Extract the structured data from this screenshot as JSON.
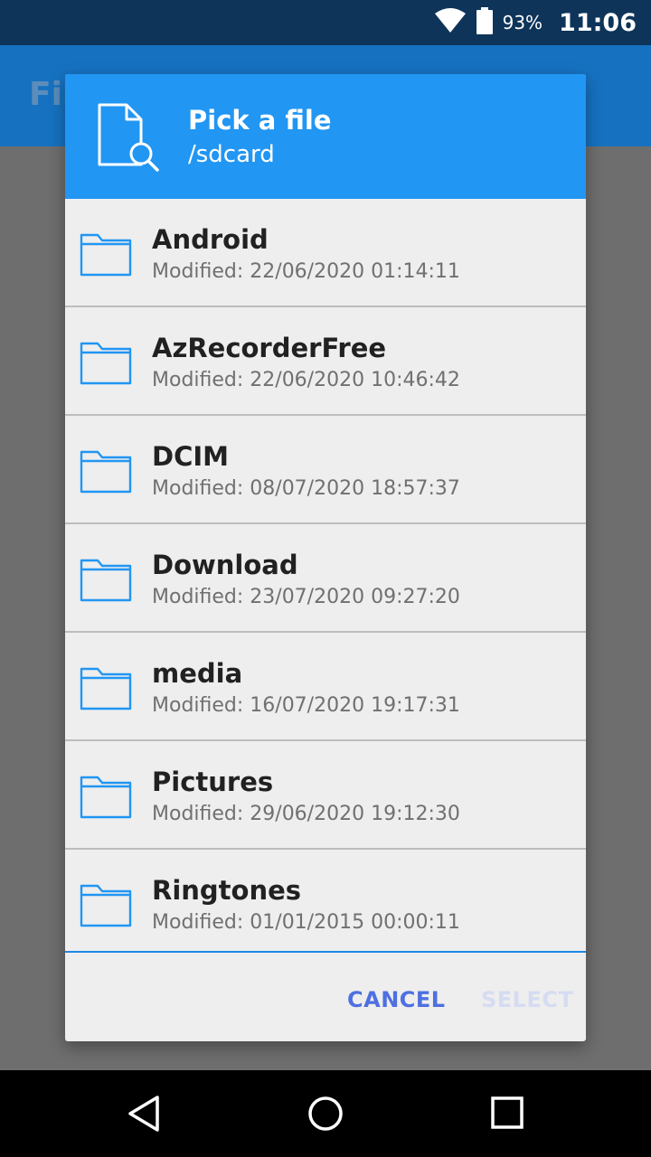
{
  "status_bar": {
    "battery_pct": "93%",
    "time": "11:06"
  },
  "app": {
    "title_partial": "Fil"
  },
  "dialog": {
    "title": "Pick a file",
    "path": "/sdcard",
    "items": [
      {
        "name": "Android",
        "modified": "Modified: 22/06/2020 01:14:11"
      },
      {
        "name": "AzRecorderFree",
        "modified": "Modified: 22/06/2020 10:46:42"
      },
      {
        "name": "DCIM",
        "modified": "Modified: 08/07/2020 18:57:37"
      },
      {
        "name": "Download",
        "modified": "Modified: 23/07/2020 09:27:20"
      },
      {
        "name": "media",
        "modified": "Modified: 16/07/2020 19:17:31"
      },
      {
        "name": "Pictures",
        "modified": "Modified: 29/06/2020 19:12:30"
      },
      {
        "name": "Ringtones",
        "modified": "Modified: 01/01/2015 00:00:11"
      }
    ],
    "cancel_label": "CANCEL",
    "select_label": "SELECT"
  },
  "colors": {
    "header": "#2196f3",
    "accent": "#4e70e0",
    "folder_icon": "#2196f3"
  },
  "icons": {
    "header": "file-search-icon",
    "item": "folder-icon"
  }
}
